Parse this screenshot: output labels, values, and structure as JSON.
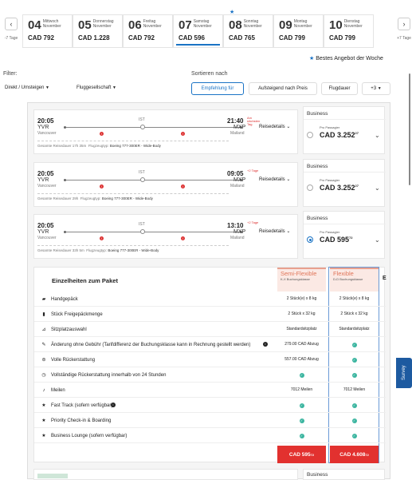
{
  "dates": {
    "prev_label": "-7 Tage",
    "next_label": "+7 Tage",
    "items": [
      {
        "day": "04",
        "weekday": "Mittwoch",
        "month": "November",
        "price": "CAD 792"
      },
      {
        "day": "05",
        "weekday": "Donnerstag",
        "month": "November",
        "price": "CAD 1.228"
      },
      {
        "day": "06",
        "weekday": "Freitag",
        "month": "November",
        "price": "CAD 792"
      },
      {
        "day": "07",
        "weekday": "Samstag",
        "month": "November",
        "price": "CAD 596"
      },
      {
        "day": "08",
        "weekday": "Sonntag",
        "month": "November",
        "price": "CAD 765"
      },
      {
        "day": "09",
        "weekday": "Montag",
        "month": "November",
        "price": "CAD 799"
      },
      {
        "day": "10",
        "weekday": "Dienstag",
        "month": "November",
        "price": "CAD 799"
      }
    ],
    "best_offer": "Bestes Angebot der Woche"
  },
  "filter": {
    "label": "Filter:",
    "stops": "Direkt / Umsteigen",
    "airline": "Fluggesellschaft"
  },
  "sort": {
    "label": "Sortieren nach",
    "options": [
      "Empfehlung für",
      "Aufsteigend nach Preis",
      "Flugdauer",
      "+3"
    ]
  },
  "flights": [
    {
      "dep_time": "20:05",
      "dep_code": "YVR",
      "dep_city": "Vancouver",
      "stop": "IST",
      "arr_time": "21:40",
      "arr_code": "MXP",
      "arr_city": "Mailand",
      "next_day": "Am nächsten Tag",
      "details": "Reisedetails",
      "duration": "Gesamte Reisedauer 17h 35m",
      "aircraft_label": "Flugzeugtyp:",
      "aircraft": "Boeing 777-300ER - Wide-Body",
      "class": "Business",
      "per_pax": "Pro Passagier",
      "price": "CAD 3.252",
      "price_sup": "27"
    },
    {
      "dep_time": "20:05",
      "dep_code": "YVR",
      "dep_city": "Vancouver",
      "stop": "IST",
      "arr_time": "09:05",
      "arr_code": "MXP",
      "arr_city": "Mailand",
      "next_day": "+2 Tage",
      "details": "Reisedetails",
      "duration": "Gesamte Reisedauer 29h",
      "aircraft_label": "Flugzeugtyp:",
      "aircraft": "Boeing 777-300ER - Wide-Body",
      "class": "Business",
      "per_pax": "Pro Passagier",
      "price": "CAD 3.252",
      "price_sup": "27"
    },
    {
      "dep_time": "20:05",
      "dep_code": "YVR",
      "dep_city": "Vancouver",
      "stop": "IST",
      "arr_time": "13:10",
      "arr_code": "MXP",
      "arr_city": "Mailand",
      "next_day": "+2 Tage",
      "details": "Reisedetails",
      "duration": "Gesamte Reisedauer 33h 5m",
      "aircraft_label": "Flugzeugtyp:",
      "aircraft": "Boeing 777-300ER - Wide-Body",
      "class": "Business",
      "per_pax": "Pro Passagier",
      "price": "CAD 595",
      "price_sup": "72"
    }
  ],
  "package": {
    "title": "Einzelheiten zum Paket",
    "col1": {
      "name": "Semi-Flexible",
      "sub": "K-X Buchungsklasse"
    },
    "col2": {
      "name": "Flexible",
      "sub": "D-D Buchungsklasse"
    },
    "col3_partial": "E",
    "rows": [
      {
        "icon": "bag-icon",
        "label": "Handgepäck",
        "v1": "2 Stück(e) x 8 kg",
        "v2": "2 Stück(e) x 8 kg"
      },
      {
        "icon": "luggage-icon",
        "label": "Stück Freigepäckmenge",
        "v1": "2 Stück x 32 kg",
        "v2": "2 Stück x 32 kg"
      },
      {
        "icon": "seat-icon",
        "label": "Sitzplatzauswahl",
        "v1": "Standardsitzplatz",
        "v2": "Standardsitzplatz"
      },
      {
        "icon": "edit-icon",
        "label": "Änderung ohne Gebühr (Tarifdifferenz der Buchungsklasse kann in Rechnung gestellt werden)",
        "v1": "279.00 CAD Abzug",
        "v2": "check"
      },
      {
        "icon": "refund-icon",
        "label": "Volle Rückerstattung",
        "v1": "557.00 CAD Abzug",
        "v2": "check"
      },
      {
        "icon": "clock-refund-icon",
        "label": "Vollständige Rückerstattung innerhalb von 24 Stunden",
        "v1": "check",
        "v2": "check"
      },
      {
        "icon": "miles-icon",
        "label": "Meilen",
        "v1": "7012 Meilen",
        "v2": "7012 Meilen"
      },
      {
        "icon": "star-icon",
        "label": "Fast Track (sofern verfügbar)",
        "v1": "check",
        "v2": "check"
      },
      {
        "icon": "star-icon",
        "label": "Priority Check-in & Boarding",
        "v1": "check",
        "v2": "check"
      },
      {
        "icon": "star-icon",
        "label": "Business Lounge (sofern verfügbar)",
        "v1": "check",
        "v2": "check"
      }
    ],
    "btn1": "CAD 595",
    "btn1_sup": "72",
    "btn2": "CAD 4.608",
    "btn2_sup": "72"
  },
  "bottom": {
    "class": "Business"
  },
  "survey": "Survey"
}
